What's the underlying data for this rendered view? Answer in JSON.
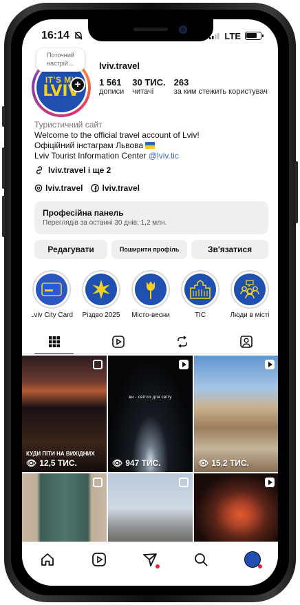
{
  "status_bar": {
    "time": "16:14",
    "network": "LTE"
  },
  "profile": {
    "mood_note": "Поточний настрій…",
    "avatar_line1": "IT'S MY",
    "avatar_line2": "LVIV",
    "username": "lviv.travel",
    "stats": [
      {
        "num": "1 561",
        "label": "дописи"
      },
      {
        "num": "30 ТИС.",
        "label": "читачі"
      },
      {
        "num": "263",
        "label": "за ким стежить користувач"
      }
    ],
    "category": "Туристичний сайт",
    "bio_line1": "Welcome to the official travel account of Lviv!",
    "bio_line2": "Офіційний інстаграм Львова",
    "bio_line3_text": "Lviv Tourist Information Center ",
    "bio_line3_mention": "@lviv.tic",
    "link": "lviv.travel і ще 2",
    "threads": "lviv.travel",
    "facebook": "lviv.travel"
  },
  "pro_panel": {
    "title": "Професійна панель",
    "subtitle": "Переглядів за останні 30 днів: 1,2 млн."
  },
  "buttons": {
    "edit": "Редагувати",
    "share": "Поширити профіль",
    "contact": "Зв'язатися"
  },
  "highlights": [
    {
      "label": "Lviv City Card",
      "icon": "city-card-icon"
    },
    {
      "label": "Різдво 2025",
      "icon": "star-icon"
    },
    {
      "label": "Місто-весни",
      "icon": "tulip-icon"
    },
    {
      "label": "ТІС",
      "icon": "building-icon"
    },
    {
      "label": "Люди в місті",
      "icon": "people-icon"
    }
  ],
  "tabs": [
    "grid-icon",
    "reels-icon",
    "reposts-icon",
    "tagged-icon"
  ],
  "posts": [
    {
      "caption": "КУДИ ПІТИ НА ВИХІДНИХ",
      "views": "12,5 ТИС.",
      "badge": "multi"
    },
    {
      "caption": "ви - світло для світу",
      "views": "947 ТИС.",
      "badge": "reel"
    },
    {
      "caption": "",
      "views": "15,2 ТИС.",
      "badge": "reel"
    },
    {
      "caption": "",
      "views": "",
      "badge": "multi"
    },
    {
      "caption": "",
      "views": "",
      "badge": "multi"
    },
    {
      "caption": "",
      "views": "",
      "badge": "reel"
    }
  ],
  "bottom_nav": [
    "home-icon",
    "reels-icon",
    "messages-icon",
    "search-icon",
    "profile-avatar"
  ],
  "colors": {
    "brand_blue": "#1f4fb0",
    "brand_yellow": "#f5d020",
    "mention": "#3a5fcc",
    "notification": "#e5243b"
  }
}
